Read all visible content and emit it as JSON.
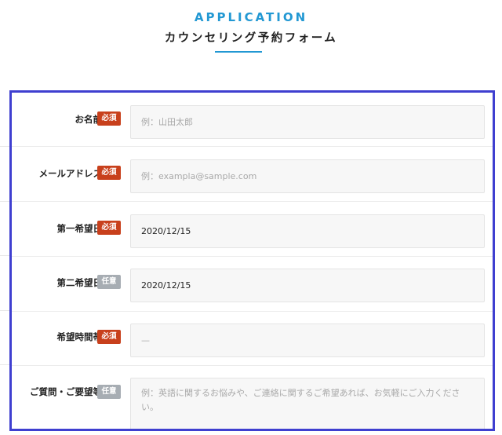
{
  "header": {
    "eyebrow": "APPLICATION",
    "title": "カウンセリング予約フォーム"
  },
  "colors": {
    "accent": "#2298d3",
    "required_badge": "#c8401c",
    "optional_badge": "#a7adb3",
    "frame_border": "#3f3fd0"
  },
  "form": {
    "fields": [
      {
        "label": "お名前",
        "badge": "必須",
        "placeholder": "例：山田太郎",
        "value": ""
      },
      {
        "label": "メールアドレス",
        "badge": "必須",
        "placeholder": "例：exampla@sample.com",
        "value": ""
      },
      {
        "label": "第一希望日",
        "badge": "必須",
        "placeholder": "",
        "value": "2020/12/15"
      },
      {
        "label": "第二希望日",
        "badge": "任意",
        "placeholder": "",
        "value": "2020/12/15"
      },
      {
        "label": "希望時間帯",
        "badge": "必須",
        "placeholder": "",
        "value": "—"
      },
      {
        "label": "ご質問・ご要望等",
        "badge": "任意",
        "placeholder": "例：英語に関するお悩みや、ご連絡に関するご希望あれば、お気軽にご入力ください。",
        "value": ""
      }
    ]
  }
}
